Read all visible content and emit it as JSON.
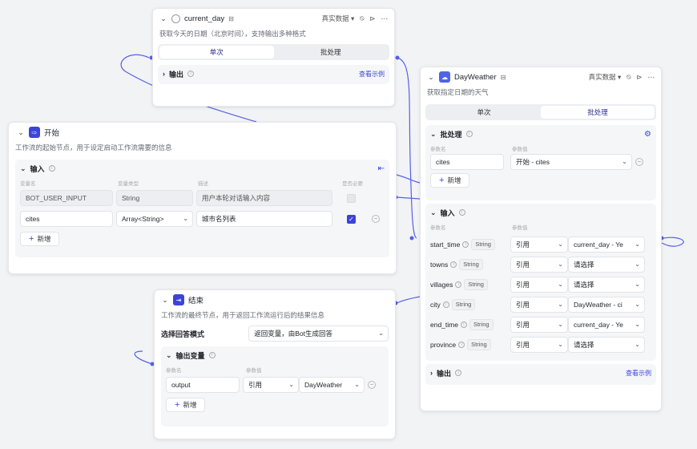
{
  "colors": {
    "accent": "#3b44d9",
    "wire": "#5561e6",
    "start_icon": "#3b44d9",
    "end_icon": "#3b44d9"
  },
  "current_day": {
    "title": "current_day",
    "data_mode": "真实数据",
    "desc": "获取今天的日期（北京时间），支持输出多种格式",
    "tab_single": "单次",
    "tab_batch": "批处理",
    "output_label": "输出",
    "view_example": "查看示例"
  },
  "start": {
    "title": "开始",
    "desc": "工作流的起始节点，用于设定启动工作流需要的信息",
    "input_label": "输入",
    "col_name": "变量名",
    "col_type": "变量类型",
    "col_desc": "描述",
    "col_required": "是否必要",
    "rows": [
      {
        "name": "BOT_USER_INPUT",
        "type": "String",
        "desc": "用户本轮对话输入内容"
      },
      {
        "name": "cites",
        "type": "Array<String>",
        "desc": "城市名列表"
      }
    ],
    "add_label": "新增"
  },
  "end": {
    "title": "结束",
    "desc": "工作流的最终节点，用于返回工作流运行后的结果信息",
    "mode_label": "选择回答模式",
    "mode_value": "返回变量，由Bot生成回答",
    "output_vars_label": "输出变量",
    "col_name": "参数名",
    "col_value": "参数值",
    "output_name": "output",
    "output_ref": "引用",
    "output_value": "DayWeather",
    "add_label": "新增"
  },
  "dayweather": {
    "title": "DayWeather",
    "data_mode": "真实数据",
    "desc": "获取指定日期的天气",
    "tab_single": "单次",
    "tab_batch": "批处理",
    "batch_label": "批处理",
    "batch_col_name": "参数名",
    "batch_col_value": "参数值",
    "batch_name": "cites",
    "batch_value": "开始 - cites",
    "add_label": "新增",
    "input_label": "输入",
    "col_name": "参数名",
    "col_value": "参数值",
    "inputs": [
      {
        "name": "start_time",
        "type": "String",
        "ref": "引用",
        "value": "current_day - Ye"
      },
      {
        "name": "towns",
        "type": "String",
        "ref": "引用",
        "value": "请选择"
      },
      {
        "name": "villages",
        "type": "String",
        "ref": "引用",
        "value": "请选择"
      },
      {
        "name": "city",
        "type": "String",
        "ref": "引用",
        "value": "DayWeather - ci"
      },
      {
        "name": "end_time",
        "type": "String",
        "ref": "引用",
        "value": "current_day - Ye"
      },
      {
        "name": "province",
        "type": "String",
        "ref": "引用",
        "value": "请选择"
      }
    ],
    "output_label": "输出",
    "view_example": "查看示例"
  }
}
